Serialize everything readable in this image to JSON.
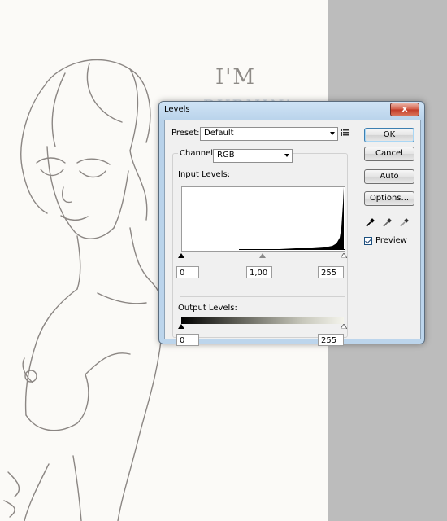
{
  "background": {
    "sketch_text_line1": "I'M",
    "sketch_text_line2": "BURNIN'"
  },
  "dialog": {
    "title": "Levels",
    "close_label": "x",
    "preset_label": "Preset:",
    "preset_value": "Default",
    "channel_label": "Channel:",
    "channel_value": "RGB",
    "input_levels_label": "Input Levels:",
    "input_black": "0",
    "input_gamma": "1,00",
    "input_white": "255",
    "output_levels_label": "Output Levels:",
    "output_black": "0",
    "output_white": "255",
    "buttons": {
      "ok": "OK",
      "cancel": "Cancel",
      "auto": "Auto",
      "options": "Options..."
    },
    "preview_label": "Preview",
    "preview_checked": true
  },
  "colors": {
    "close_button": "#d35a45",
    "dialog_frame": "#bcd5ec"
  }
}
